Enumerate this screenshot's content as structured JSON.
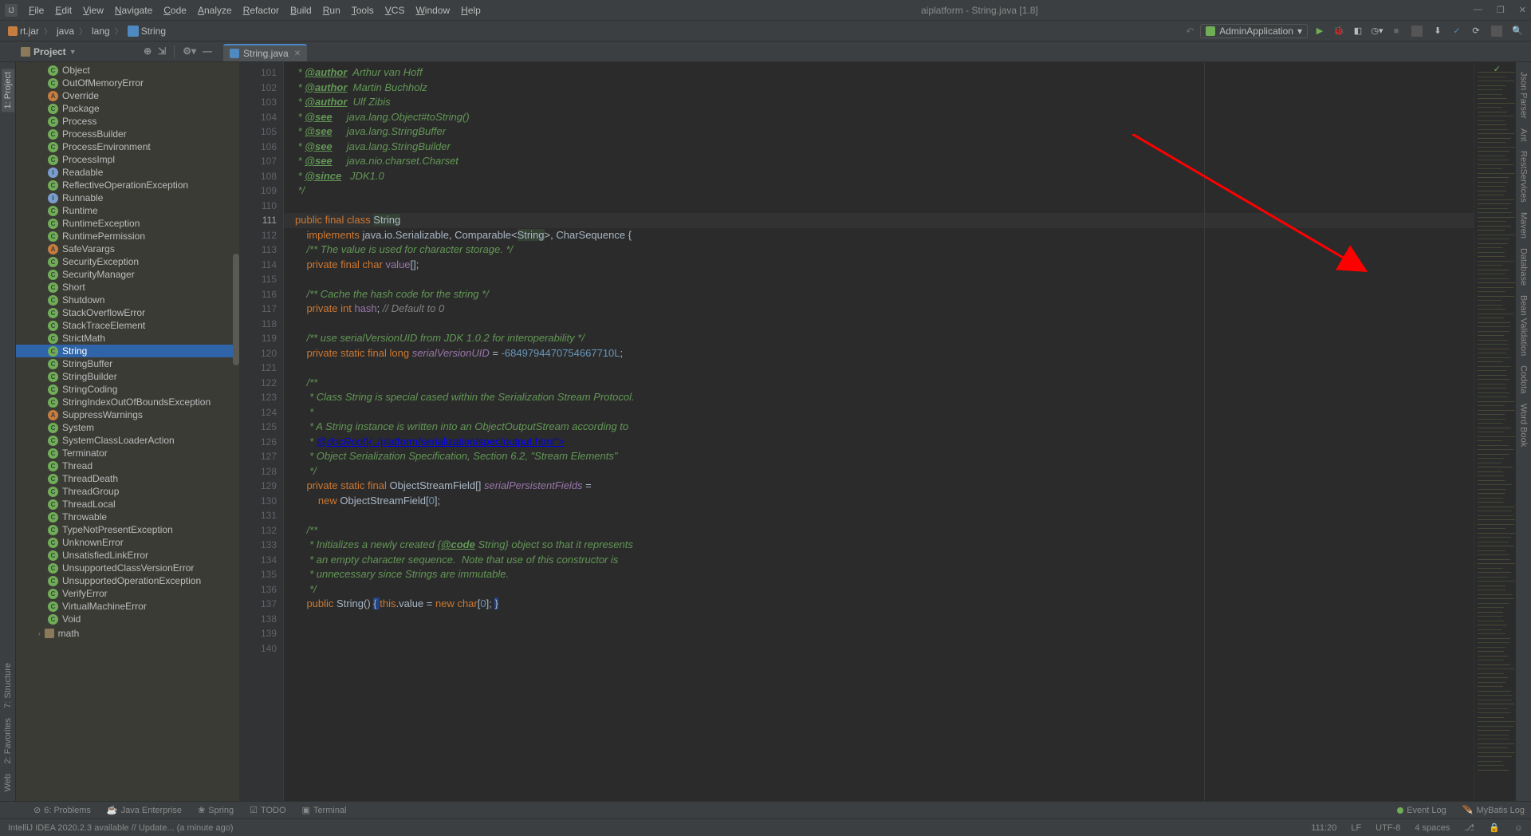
{
  "title": {
    "text": "aiplatform - String.java [1.8]"
  },
  "menu": [
    "File",
    "Edit",
    "View",
    "Navigate",
    "Code",
    "Analyze",
    "Refactor",
    "Build",
    "Run",
    "Tools",
    "VCS",
    "Window",
    "Help"
  ],
  "breadcrumb": {
    "items": [
      "rt.jar",
      "java",
      "lang",
      "String"
    ]
  },
  "runConfig": {
    "label": "AdminApplication",
    "dropdown": "▾"
  },
  "projectLabel": "Project",
  "editorTab": {
    "name": "String.java"
  },
  "leftTabs": {
    "project": "1: Project",
    "structure": "7: Structure",
    "favorites": "2: Favorites",
    "web": "Web"
  },
  "rightTabs": [
    "Json Parser",
    "Ant",
    "RestServices",
    "Maven",
    "Database",
    "Bean Validation",
    "Codota",
    "Word Book"
  ],
  "tree": [
    {
      "icon": "c",
      "label": "Object"
    },
    {
      "icon": "c",
      "label": "OutOfMemoryError"
    },
    {
      "icon": "a",
      "label": "Override"
    },
    {
      "icon": "c",
      "label": "Package"
    },
    {
      "icon": "c",
      "label": "Process"
    },
    {
      "icon": "c",
      "label": "ProcessBuilder"
    },
    {
      "icon": "c",
      "label": "ProcessEnvironment"
    },
    {
      "icon": "c",
      "label": "ProcessImpl"
    },
    {
      "icon": "i",
      "label": "Readable"
    },
    {
      "icon": "c",
      "label": "ReflectiveOperationException"
    },
    {
      "icon": "i",
      "label": "Runnable"
    },
    {
      "icon": "c",
      "label": "Runtime"
    },
    {
      "icon": "c",
      "label": "RuntimeException"
    },
    {
      "icon": "c",
      "label": "RuntimePermission"
    },
    {
      "icon": "a",
      "label": "SafeVarargs"
    },
    {
      "icon": "c",
      "label": "SecurityException"
    },
    {
      "icon": "c",
      "label": "SecurityManager"
    },
    {
      "icon": "c",
      "label": "Short"
    },
    {
      "icon": "c",
      "label": "Shutdown"
    },
    {
      "icon": "c",
      "label": "StackOverflowError"
    },
    {
      "icon": "c",
      "label": "StackTraceElement"
    },
    {
      "icon": "c",
      "label": "StrictMath"
    },
    {
      "icon": "c",
      "label": "String",
      "selected": true
    },
    {
      "icon": "c",
      "label": "StringBuffer"
    },
    {
      "icon": "c",
      "label": "StringBuilder"
    },
    {
      "icon": "c",
      "label": "StringCoding"
    },
    {
      "icon": "c",
      "label": "StringIndexOutOfBoundsException"
    },
    {
      "icon": "a",
      "label": "SuppressWarnings"
    },
    {
      "icon": "c",
      "label": "System"
    },
    {
      "icon": "c",
      "label": "SystemClassLoaderAction"
    },
    {
      "icon": "c",
      "label": "Terminator"
    },
    {
      "icon": "c",
      "label": "Thread"
    },
    {
      "icon": "c",
      "label": "ThreadDeath"
    },
    {
      "icon": "c",
      "label": "ThreadGroup"
    },
    {
      "icon": "c",
      "label": "ThreadLocal"
    },
    {
      "icon": "c",
      "label": "Throwable"
    },
    {
      "icon": "c",
      "label": "TypeNotPresentException"
    },
    {
      "icon": "c",
      "label": "UnknownError"
    },
    {
      "icon": "c",
      "label": "UnsatisfiedLinkError"
    },
    {
      "icon": "c",
      "label": "UnsupportedClassVersionError"
    },
    {
      "icon": "c",
      "label": "UnsupportedOperationException"
    },
    {
      "icon": "c",
      "label": "VerifyError"
    },
    {
      "icon": "c",
      "label": "VirtualMachineError"
    },
    {
      "icon": "c",
      "label": "Void"
    }
  ],
  "treeFolder": {
    "label": "math"
  },
  "lineStart": 101,
  "lineEnd": 140,
  "code": {
    "l101": {
      "pre": " * ",
      "tag": "@author",
      "post": "  Arthur van Hoff"
    },
    "l102": {
      "pre": " * ",
      "tag": "@author",
      "post": "  Martin Buchholz"
    },
    "l103": {
      "pre": " * ",
      "tag": "@author",
      "post": "  Ulf Zibis"
    },
    "l104": {
      "pre": " * ",
      "tag": "@see",
      "post": "     java.lang.Object#toString()"
    },
    "l105": {
      "pre": " * ",
      "tag": "@see",
      "post": "     java.lang.StringBuffer"
    },
    "l106": {
      "pre": " * ",
      "tag": "@see",
      "post": "     java.lang.StringBuilder"
    },
    "l107": {
      "pre": " * ",
      "tag": "@see",
      "post": "     java.nio.charset.Charset"
    },
    "l108": {
      "pre": " * ",
      "tag": "@since",
      "post": "   JDK1.0"
    },
    "l109": " */",
    "l111": {
      "pub": "public final class ",
      "cls": "String"
    },
    "l112": {
      "impl": "implements ",
      "post": "java.io.Serializable, Comparable<",
      "hl": "String",
      "post2": ">, CharSequence {"
    },
    "l113": "/** The value is used for character storage. */",
    "l114": {
      "a": "private final char ",
      "b": "value",
      "c": "[];"
    },
    "l116": "/** Cache the hash code for the string */",
    "l117": {
      "a": "private int ",
      "b": "hash",
      "c": "; ",
      "d": "// Default to 0"
    },
    "l119": "/** use serialVersionUID from JDK 1.0.2 for interoperability */",
    "l120": {
      "a": "private static final long ",
      "b": "serialVersionUID",
      "c": " = ",
      "d": "-6849794470754667710L",
      "e": ";"
    },
    "l122": "/**",
    "l123": " * Class String is special cased within the Serialization Stream Protocol.",
    "l124": " *",
    "l125": " * A String instance is written into an ObjectOutputStream according to",
    "l126": {
      "pre": " * <a href=\"{",
      "tag": "@docRoot",
      "post": "}/../platform/serialization/spec/output.html\">"
    },
    "l127": " * Object Serialization Specification, Section 6.2, \"Stream Elements\"</a>",
    "l128": " */",
    "l129": {
      "a": "private static final ",
      "b": "ObjectStreamField[] ",
      "c": "serialPersistentFields",
      "d": " ="
    },
    "l130": {
      "a": "new ",
      "b": "ObjectStreamField[",
      "c": "0",
      "d": "];"
    },
    "l132": "/**",
    "l133": {
      "pre": " * Initializes a newly created {",
      "tag": "@code",
      "post": " String} object so that it represents"
    },
    "l134": " * an empty character sequence.  Note that use of this constructor is",
    "l135": " * unnecessary since Strings are immutable.",
    "l136": " */",
    "l137": {
      "a": "public ",
      "b": "String() ",
      "br1": "{ ",
      "c": "this",
      "d": ".value = ",
      "e": "new char",
      "f": "[",
      "g": "0",
      "h": "]; ",
      "br2": "}"
    }
  },
  "bottomTabs": [
    "6: Problems",
    "Java Enterprise",
    "Spring",
    "TODO",
    "Terminal"
  ],
  "eventLog": "Event Log",
  "mybatisLog": "MyBatis Log",
  "status": {
    "update": "IntelliJ IDEA 2020.2.3 available // Update... (a minute ago)",
    "pos": "111:20",
    "eol": "LF",
    "enc": "UTF-8",
    "indent": "4 spaces",
    "branch": "⎇"
  }
}
